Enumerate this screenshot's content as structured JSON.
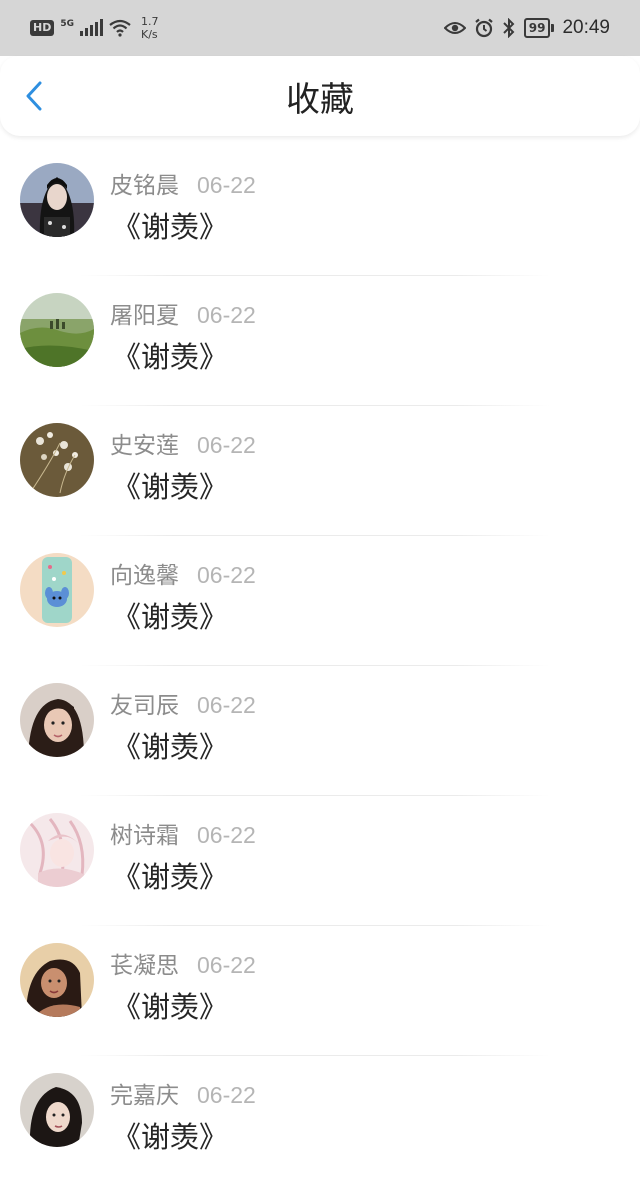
{
  "status_bar": {
    "network_badge": "HD",
    "network_type": "5G",
    "speed_value": "1.7",
    "speed_unit": "K/s",
    "battery": "99",
    "time": "20:49"
  },
  "header": {
    "title": "收藏",
    "back_icon": "chevron-left-icon",
    "accent": "#2e8fe0"
  },
  "favorites": [
    {
      "name": "皮铭晨",
      "date": "06-22",
      "title": "《谢羡》"
    },
    {
      "name": "屠阳夏",
      "date": "06-22",
      "title": "《谢羡》"
    },
    {
      "name": "史安莲",
      "date": "06-22",
      "title": "《谢羡》"
    },
    {
      "name": "向逸馨",
      "date": "06-22",
      "title": "《谢羡》"
    },
    {
      "name": "友司辰",
      "date": "06-22",
      "title": "《谢羡》"
    },
    {
      "name": "树诗霜",
      "date": "06-22",
      "title": "《谢羡》"
    },
    {
      "name": "苌凝思",
      "date": "06-22",
      "title": "《谢羡》"
    },
    {
      "name": "完嘉庆",
      "date": "06-22",
      "title": "《谢羡》"
    }
  ]
}
